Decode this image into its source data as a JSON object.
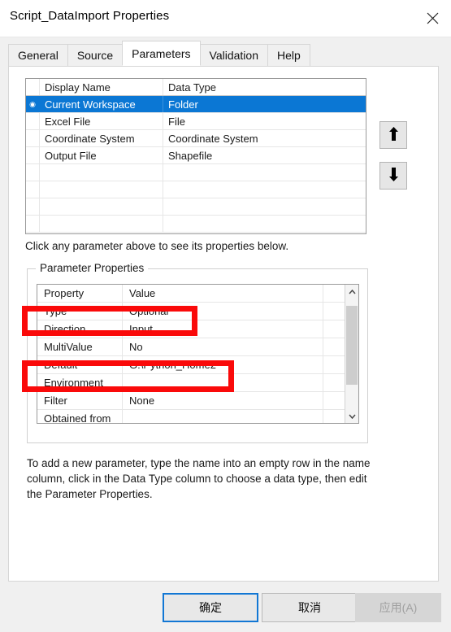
{
  "window": {
    "title": "Script_DataImport Properties",
    "close_icon": "close-icon"
  },
  "tabs": [
    {
      "label": "General",
      "active": false
    },
    {
      "label": "Source",
      "active": false
    },
    {
      "label": "Parameters",
      "active": true
    },
    {
      "label": "Validation",
      "active": false
    },
    {
      "label": "Help",
      "active": false
    }
  ],
  "parameter_grid": {
    "columns": [
      "Display Name",
      "Data Type"
    ],
    "row_marker": "◉",
    "rows": [
      {
        "display_name": "Current Workspace",
        "data_type": "Folder",
        "selected": true
      },
      {
        "display_name": "Excel File",
        "data_type": "File",
        "selected": false
      },
      {
        "display_name": "Coordinate System",
        "data_type": "Coordinate System",
        "selected": false
      },
      {
        "display_name": "Output File",
        "data_type": "Shapefile",
        "selected": false
      },
      {
        "display_name": "",
        "data_type": "",
        "selected": false
      },
      {
        "display_name": "",
        "data_type": "",
        "selected": false
      },
      {
        "display_name": "",
        "data_type": "",
        "selected": false
      },
      {
        "display_name": "",
        "data_type": "",
        "selected": false
      }
    ]
  },
  "hint_text": "Click any parameter above to see its properties below.",
  "move_buttons": {
    "up": {
      "icon": "arrow-up-icon"
    },
    "down": {
      "icon": "arrow-down-icon"
    }
  },
  "parameter_properties": {
    "group_label": "Parameter Properties",
    "columns": [
      "Property",
      "Value"
    ],
    "rows": [
      {
        "property": "Property",
        "value": "Value",
        "header": true
      },
      {
        "property": "Type",
        "value": "Optional",
        "header": false
      },
      {
        "property": "Direction",
        "value": "Input",
        "header": false
      },
      {
        "property": "MultiValue",
        "value": "No",
        "header": false
      },
      {
        "property": "Default",
        "value": "G:\\Python_Home2",
        "header": false
      },
      {
        "property": "Environment",
        "value": "",
        "header": false
      },
      {
        "property": "Filter",
        "value": "None",
        "header": false
      },
      {
        "property": "Obtained from",
        "value": "",
        "header": false
      }
    ],
    "scrollbar": {
      "up_icon": "chevron-up-icon",
      "down_icon": "chevron-down-icon"
    }
  },
  "annotations": {
    "color": "#fa0a0a",
    "boxes": [
      {
        "name": "highlight-type-row",
        "target": "Type"
      },
      {
        "name": "highlight-default-row",
        "target": "Default"
      }
    ]
  },
  "instructions": "To add a new parameter, type the name into an empty row in the name column, click in the Data Type column to choose a data type, then edit the Parameter Properties.",
  "footer": {
    "ok_label": "确定",
    "cancel_label": "取消",
    "apply_label": "应用(A)",
    "apply_disabled": true
  },
  "colors": {
    "selection_blue": "#0b77d4",
    "focus_blue": "#1277d4",
    "annotation_red": "#fa0a0a",
    "panel_bg": "#f0f0f0"
  }
}
